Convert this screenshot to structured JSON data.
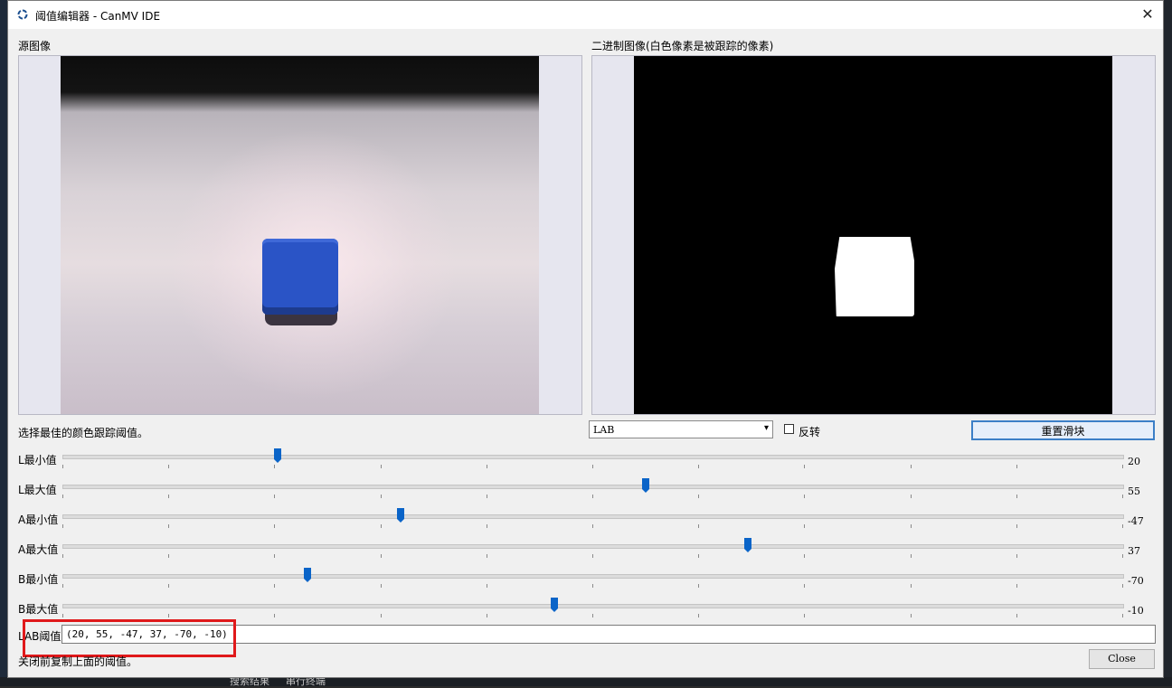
{
  "window": {
    "title": "阈值编辑器 - CanMV IDE",
    "close_glyph": "✕"
  },
  "source_panel": {
    "label": "源图像"
  },
  "binary_panel": {
    "label": "二进制图像(白色像素是被跟踪的像素)"
  },
  "instruction": "选择最佳的颜色跟踪阈值。",
  "color_space": {
    "selected": "LAB",
    "arrow": "▾"
  },
  "invert": {
    "label": "反转",
    "checked": false
  },
  "reset_button": "重置滑块",
  "sliders": [
    {
      "label": "L最小值",
      "value": "20",
      "fraction": 0.203
    },
    {
      "label": "L最大值",
      "value": "55",
      "fraction": 0.55
    },
    {
      "label": "A最小值",
      "value": "-47",
      "fraction": 0.319
    },
    {
      "label": "A最大值",
      "value": "37",
      "fraction": 0.647
    },
    {
      "label": "B最小值",
      "value": "-70",
      "fraction": 0.231
    },
    {
      "label": "B最大值",
      "value": "-10",
      "fraction": 0.464
    }
  ],
  "lab_threshold": {
    "label": "LAB阈值",
    "value": "(20, 55, -47, 37, -70, -10)"
  },
  "footer_note": "关闭前复制上面的阈值。",
  "close_button": "Close",
  "colors": {
    "accent": "#0a64c8",
    "highlight_box": "#e0191b"
  },
  "taskbar": [
    "搜索结果",
    "串行终端"
  ]
}
